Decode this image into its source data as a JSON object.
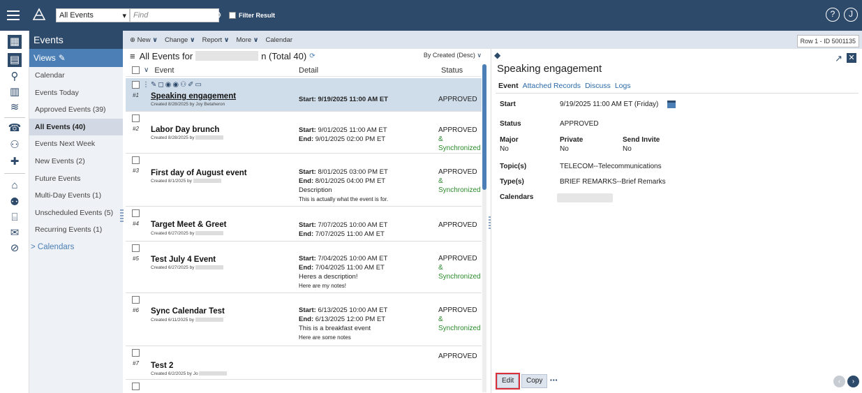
{
  "topbar": {
    "event_select": "All Events",
    "find_placeholder": "Find",
    "filter_label": "Filter Result",
    "help_icon": "?",
    "user_initial": "J"
  },
  "sidebar": {
    "title": "Events",
    "views_label": "Views",
    "items": [
      {
        "label": "Calendar",
        "active": false
      },
      {
        "label": "Events Today",
        "active": false
      },
      {
        "label": "Approved Events (39)",
        "active": false
      },
      {
        "label": "All Events (40)",
        "active": true
      },
      {
        "label": "Events Next Week",
        "active": false
      },
      {
        "label": "New Events (2)",
        "active": false
      },
      {
        "label": "Future Events",
        "active": false
      },
      {
        "label": "Multi-Day Events (1)",
        "active": false
      },
      {
        "label": "Unscheduled Events (5)",
        "active": false
      },
      {
        "label": "Recurring Events (1)",
        "active": false
      }
    ],
    "calendars_label": "> Calendars"
  },
  "toolbar": {
    "new": "New",
    "change": "Change",
    "report": "Report",
    "more": "More",
    "calendar": "Calendar",
    "row_tag": "Row 1 - ID 5001135"
  },
  "list": {
    "title_prefix": "All Events for",
    "title_suffix": "n (Total 40)",
    "sort_label": "By Created (Desc)",
    "col_event": "Event",
    "col_detail": "Detail",
    "col_status": "Status",
    "rows": [
      {
        "num": "#1",
        "name": "Speaking engagement",
        "created": "Created 8/28/2025 by Joy Betaheron",
        "detail1_label": "Start:",
        "detail1": "9/19/2025 11:00 AM ET",
        "status": "APPROVED"
      },
      {
        "num": "#2",
        "name": "Labor Day brunch",
        "created": "Created 8/28/2025 by",
        "detail1_label": "Start:",
        "detail1": "9/01/2025 11:00 AM ET",
        "detail2_label": "End:",
        "detail2": "9/01/2025 02:00 PM ET",
        "status": "APPROVED",
        "amp": "&",
        "sync": "Synchronized"
      },
      {
        "num": "#3",
        "name": "First day of August event",
        "created": "Created 8/1/2025 by",
        "detail1_label": "Start:",
        "detail1": "8/01/2025 03:00 PM ET",
        "detail2_label": "End:",
        "detail2": "8/01/2025 04:00 PM ET",
        "detail3": "Description",
        "detail4": "This is actually what the event is for.",
        "status": "APPROVED",
        "amp": "&",
        "sync": "Synchronized"
      },
      {
        "num": "#4",
        "name": "Target Meet & Greet",
        "created": "Created 6/27/2025 by",
        "detail1_label": "Start:",
        "detail1": "7/07/2025 10:00 AM ET",
        "detail2_label": "End:",
        "detail2": "7/07/2025 11:00 AM ET",
        "status": "APPROVED"
      },
      {
        "num": "#5",
        "name": "Test July 4 Event",
        "created": "Created 6/27/2025 by",
        "detail1_label": "Start:",
        "detail1": "7/04/2025 10:00 AM ET",
        "detail2_label": "End:",
        "detail2": "7/04/2025 11:00 AM ET",
        "detail3": "Heres a description!",
        "detail4": "Here are my notes!",
        "status": "APPROVED",
        "amp": "&",
        "sync": "Synchronized"
      },
      {
        "num": "#6",
        "name": "Sync Calendar Test",
        "created": "Created 6/11/2025 by",
        "detail1_label": "Start:",
        "detail1": "6/13/2025 10:00 AM ET",
        "detail2_label": "End:",
        "detail2": "6/13/2025 12:00 PM ET",
        "detail3": "This is a breakfast event",
        "detail4": "Here are some notes",
        "status": "APPROVED",
        "amp": "&",
        "sync": "Synchronized"
      },
      {
        "num": "#7",
        "name": "Test 2",
        "created": "Created 6/2/2025 by Jo",
        "status": "APPROVED"
      }
    ]
  },
  "panel": {
    "title": "Speaking engagement",
    "tabs": [
      "Event",
      "Attached Records",
      "Discuss",
      "Logs"
    ],
    "start_label": "Start",
    "start_value": "9/19/2025 11:00 AM ET (Friday)",
    "status_label": "Status",
    "status_value": "APPROVED",
    "major_label": "Major",
    "major_value": "No",
    "private_label": "Private",
    "private_value": "No",
    "invite_label": "Send Invite",
    "invite_value": "No",
    "topics_label": "Topic(s)",
    "topics_value": "TELECOM--Telecommunications",
    "types_label": "Type(s)",
    "types_value": "BRIEF REMARKS--Brief Remarks",
    "calendars_label": "Calendars",
    "edit": "Edit",
    "copy": "Copy",
    "more": "▪▪▪"
  },
  "colors": {
    "topbar": "#2e4a6b",
    "accent": "#4b7fb5",
    "sync": "#2b8a2b",
    "edit_outline": "#d9303a"
  }
}
